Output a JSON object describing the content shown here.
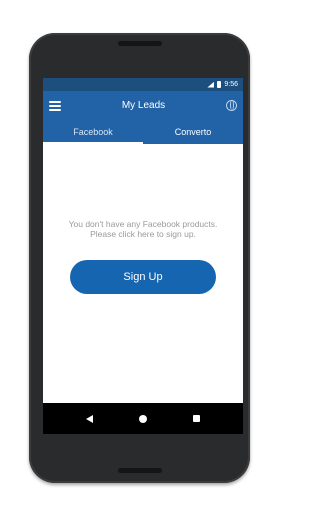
{
  "status_bar": {
    "time": "9:56",
    "icons": [
      "wifi-icon",
      "battery-icon"
    ]
  },
  "app_bar": {
    "title": "My Leads",
    "menu_icon": "menu-icon",
    "action_icon": "globe-icon"
  },
  "tabs": [
    {
      "label": "Facebook",
      "active": true
    },
    {
      "label": "Converto",
      "active": false
    }
  ],
  "content": {
    "message_line1": "You don't have any Facebook products.",
    "message_line2": "Please click here to sign up.",
    "button_label": "Sign Up"
  },
  "nav_bar": {
    "icons": [
      "back-icon",
      "home-icon",
      "recents-icon"
    ]
  },
  "colors": {
    "primary": "#2163a6",
    "status_bar": "#1d4f7e",
    "button": "#1565b0",
    "message_text": "#9a9a9a"
  }
}
